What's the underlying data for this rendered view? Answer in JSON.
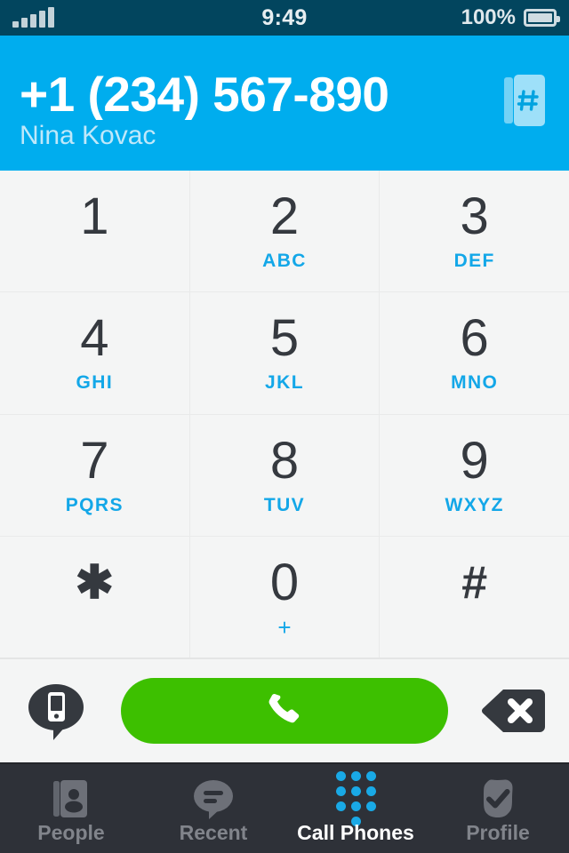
{
  "status_bar": {
    "time": "9:49",
    "battery_percent": "100%",
    "signal_icon": "signal-bars-icon",
    "battery_icon": "battery-full-icon",
    "background_color": "#02455e"
  },
  "header": {
    "dialed_number": "+1 (234) 567-890",
    "contact_name": "Nina Kovac",
    "contacts_icon": "contacts-book-hash-icon",
    "background_color": "#00adee"
  },
  "keypad": {
    "keys": [
      {
        "digit": "1",
        "letters": ""
      },
      {
        "digit": "2",
        "letters": "ABC"
      },
      {
        "digit": "3",
        "letters": "DEF"
      },
      {
        "digit": "4",
        "letters": "GHI"
      },
      {
        "digit": "5",
        "letters": "JKL"
      },
      {
        "digit": "6",
        "letters": "MNO"
      },
      {
        "digit": "7",
        "letters": "PQRS"
      },
      {
        "digit": "8",
        "letters": "TUV"
      },
      {
        "digit": "9",
        "letters": "WXYZ"
      },
      {
        "digit": "✱",
        "letters": ""
      },
      {
        "digit": "0",
        "letters": "+"
      },
      {
        "digit": "#",
        "letters": ""
      }
    ],
    "digit_color": "#35393f",
    "letter_color": "#13a7e8"
  },
  "action_bar": {
    "sms_icon": "mobile-message-bubble-icon",
    "call_icon": "phone-handset-icon",
    "backspace_icon": "backspace-delete-icon",
    "call_button_color": "#3dc000"
  },
  "tab_bar": {
    "tabs": [
      {
        "label": "People",
        "icon": "contacts-book-person-icon",
        "active": false
      },
      {
        "label": "Recent",
        "icon": "chat-bubble-icon",
        "active": false
      },
      {
        "label": "Call Phones",
        "icon": "dialpad-dots-icon",
        "active": true
      },
      {
        "label": "Profile",
        "icon": "check-badge-icon",
        "active": false
      }
    ],
    "active_color": "#19a9e6",
    "inactive_color": "#81848b",
    "background_color": "#2e3138"
  }
}
